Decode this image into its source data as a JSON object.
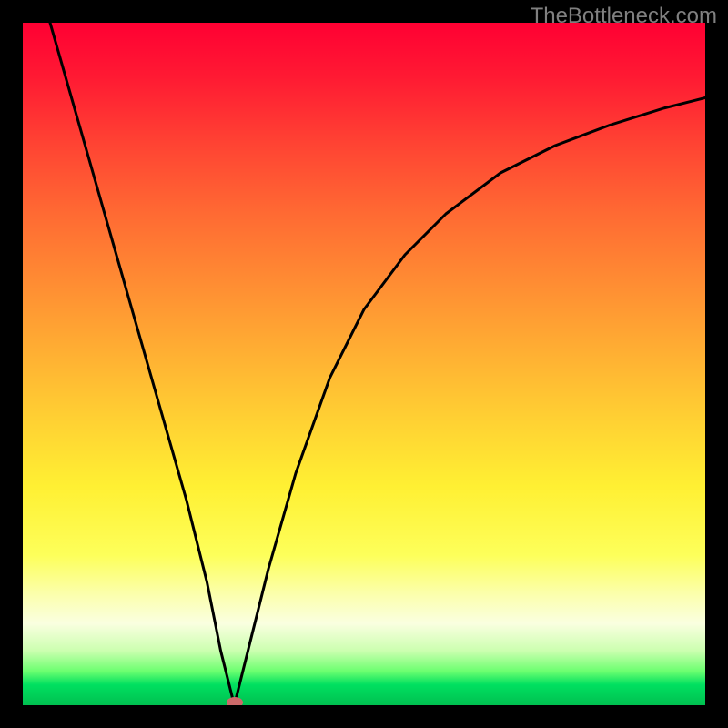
{
  "watermark": "TheBottleneck.com",
  "chart_data": {
    "type": "line",
    "title": "",
    "xlabel": "",
    "ylabel": "",
    "xlim": [
      0,
      100
    ],
    "ylim": [
      0,
      100
    ],
    "grid": false,
    "curve": {
      "x": [
        4,
        8,
        12,
        16,
        20,
        24,
        27,
        29,
        30.5,
        31,
        31.5,
        33,
        36,
        40,
        45,
        50,
        56,
        62,
        70,
        78,
        86,
        94,
        100
      ],
      "y": [
        100,
        86,
        72,
        58,
        44,
        30,
        18,
        8,
        2,
        0,
        2,
        8,
        20,
        34,
        48,
        58,
        66,
        72,
        78,
        82,
        85,
        87.5,
        89
      ]
    },
    "marker": {
      "x": 31,
      "y": 0
    },
    "background_gradient": {
      "top": "#ff0033",
      "mid": "#ffd033",
      "bottom": "#00c050"
    }
  }
}
